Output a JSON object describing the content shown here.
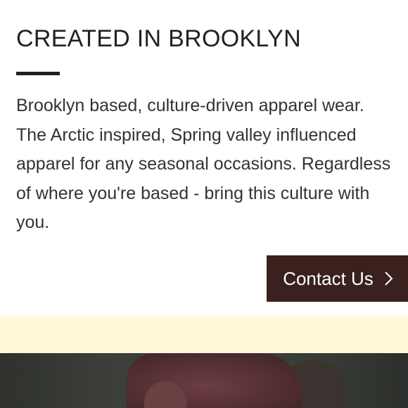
{
  "about": {
    "heading": "CREATED IN BROOKLYN",
    "body": "Brooklyn based, culture-driven apparel wear. The Arctic inspired, Spring valley influenced apparel for any seasonal occasions. Regardless of where you're based - bring this culture with you."
  },
  "cta": {
    "label": "Contact Us",
    "icon": "chevron-right-icon"
  },
  "colors": {
    "text": "#222222",
    "button_bg": "#3a211d",
    "button_text": "#ffffff",
    "band": "#fff9d9"
  }
}
